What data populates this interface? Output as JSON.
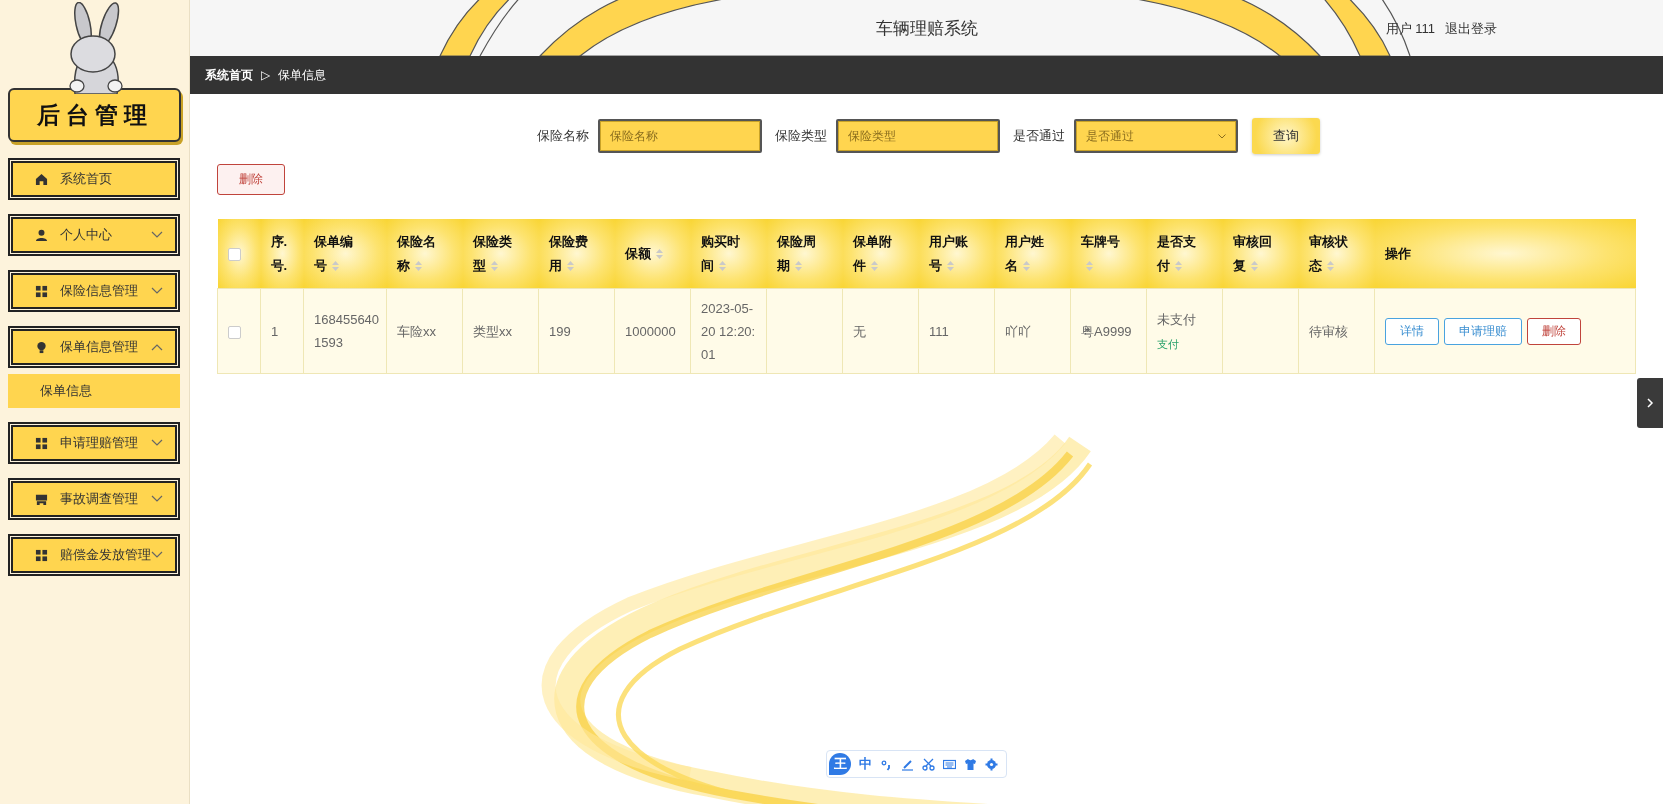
{
  "sidebar": {
    "title": "后台管理",
    "items": [
      {
        "label": "系统首页",
        "kind": "link"
      },
      {
        "label": "个人中心",
        "kind": "group",
        "expanded": false
      },
      {
        "label": "保险信息管理",
        "kind": "group",
        "expanded": false
      },
      {
        "label": "保单信息管理",
        "kind": "group",
        "expanded": true,
        "children": [
          {
            "label": "保单信息",
            "selected": true
          }
        ]
      },
      {
        "label": "申请理赔管理",
        "kind": "group",
        "expanded": false
      },
      {
        "label": "事故调查管理",
        "kind": "group",
        "expanded": false
      },
      {
        "label": "赔偿金发放管理",
        "kind": "group",
        "expanded": false
      }
    ]
  },
  "header": {
    "title": "车辆理赔系统",
    "user": "用户 111",
    "logout": "退出登录"
  },
  "breadcrumb": {
    "items": [
      "系统首页",
      "保单信息"
    ],
    "separator": "▷"
  },
  "search": {
    "fields": [
      {
        "label": "保险名称",
        "placeholder": "保险名称",
        "kind": "input"
      },
      {
        "label": "保险类型",
        "placeholder": "保险类型",
        "kind": "input"
      },
      {
        "label": "是否通过",
        "placeholder": "是否通过",
        "kind": "select"
      }
    ],
    "button": "查询"
  },
  "delete_button": "删除",
  "table": {
    "select_all": false,
    "columns": [
      {
        "label": "序.号.",
        "sortable": false
      },
      {
        "label": "保单编号",
        "sortable": true
      },
      {
        "label": "保险名称",
        "sortable": true
      },
      {
        "label": "保险类型",
        "sortable": true
      },
      {
        "label": "保险费用",
        "sortable": true
      },
      {
        "label": "保额",
        "sortable": true
      },
      {
        "label": "购买时间",
        "sortable": true
      },
      {
        "label": "保险周期",
        "sortable": true
      },
      {
        "label": "保单附件",
        "sortable": true
      },
      {
        "label": "用户账号",
        "sortable": true
      },
      {
        "label": "用户姓名",
        "sortable": true
      },
      {
        "label": "车牌号",
        "sortable": true
      },
      {
        "label": "是否支付",
        "sortable": true
      },
      {
        "label": "审核回复",
        "sortable": true
      },
      {
        "label": "审核状态",
        "sortable": true
      },
      {
        "label": "操作",
        "sortable": false
      }
    ],
    "rows": [
      {
        "checked": false,
        "cells": [
          "1",
          "1684556401593",
          "车险xx",
          "类型xx",
          "199",
          "1000000",
          "2023-05-20 12:20:01",
          "",
          "无",
          "111",
          "吖吖",
          "粤A9999"
        ],
        "payment": {
          "status": "未支付",
          "action": "支付"
        },
        "reply": "",
        "review": "待审核",
        "actions": [
          {
            "label": "详情",
            "kind": "info"
          },
          {
            "label": "申请理赔",
            "kind": "info"
          },
          {
            "label": "删除",
            "kind": "danger"
          }
        ]
      }
    ]
  },
  "ime_toolbar": {
    "logo": "王",
    "mode": "中"
  }
}
